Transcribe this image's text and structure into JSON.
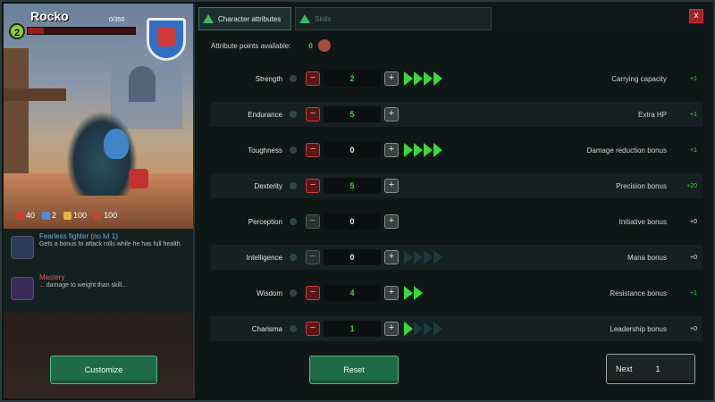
{
  "character": {
    "name": "Rocko",
    "level": "2",
    "xp_text": "0/350",
    "xp_fraction": 0.15,
    "stats": [
      {
        "icon": "heart-icon",
        "value": "40",
        "color": "#d23a3a"
      },
      {
        "icon": "shield-icon",
        "value": "2",
        "color": "#4a8fe0"
      },
      {
        "icon": "star-icon",
        "value": "100",
        "color": "#e0b73a"
      },
      {
        "icon": "sword-icon",
        "value": "100",
        "color": "#b84a3a"
      }
    ]
  },
  "perks": [
    {
      "icon": "perk-fighter-icon",
      "title": "Fearless fighter (no lvl 1)",
      "desc": "Gets a bonus to attack rolls while he has full health."
    },
    {
      "icon": "perk-mask-icon",
      "title": "Mastery",
      "desc": "... damage to weight than skill..."
    }
  ],
  "buttons": {
    "customize": "Customize",
    "reset": "Reset",
    "next": "Next"
  },
  "next_cost": "1",
  "tabs": [
    {
      "label": "Character attributes",
      "active": true
    },
    {
      "label": "Skills",
      "active": false
    }
  ],
  "close_label": "x",
  "points": {
    "label": "Attribute points available:",
    "value": "0"
  },
  "attributes": [
    {
      "label": "Strength",
      "value": "2",
      "minus_active": true,
      "arrows_on": 4,
      "arrows_total": 4,
      "derived_label": "Carrying capacity",
      "derived_value": "+1",
      "derived_green": true
    },
    {
      "label": "Endurance",
      "value": "5",
      "minus_active": true,
      "arrows_on": 0,
      "arrows_total": 0,
      "derived_label": "Extra HP",
      "derived_value": "+1",
      "derived_green": true
    },
    {
      "label": "Toughness",
      "value": "0",
      "minus_active": true,
      "arrows_on": 4,
      "arrows_total": 4,
      "derived_label": "Damage reduction bonus",
      "derived_value": "+1",
      "derived_green": true
    },
    {
      "label": "Dexterity",
      "value": "5",
      "minus_active": true,
      "arrows_on": 0,
      "arrows_total": 0,
      "derived_label": "Precision bonus",
      "derived_value": "+20",
      "derived_green": true
    },
    {
      "label": "Perception",
      "value": "0",
      "minus_active": false,
      "arrows_on": 0,
      "arrows_total": 0,
      "derived_label": "Initiative bonus",
      "derived_value": "+0",
      "derived_green": false
    },
    {
      "label": "Intelligence",
      "value": "0",
      "minus_active": false,
      "arrows_on": 0,
      "arrows_total": 4,
      "derived_label": "Mana bonus",
      "derived_value": "+0",
      "derived_green": false
    },
    {
      "label": "Wisdom",
      "value": "4",
      "minus_active": true,
      "arrows_on": 2,
      "arrows_total": 2,
      "derived_label": "Resistance bonus",
      "derived_value": "+1",
      "derived_green": true
    },
    {
      "label": "Charisma",
      "value": "1",
      "minus_active": true,
      "arrows_on": 1,
      "arrows_total": 4,
      "derived_label": "Leadership bonus",
      "derived_value": "+0",
      "derived_green": false
    }
  ]
}
